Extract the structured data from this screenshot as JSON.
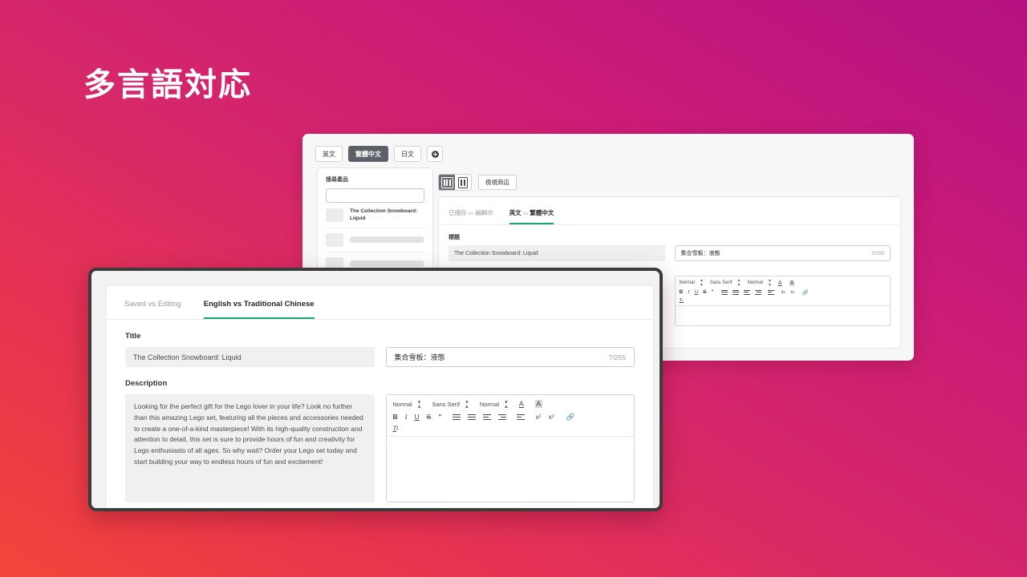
{
  "headline": "多言語対応",
  "colors": {
    "gradient_start": "#f4453a",
    "gradient_mid": "#d6276a",
    "gradient_end": "#b51283",
    "accent_green": "#18a37e",
    "tab_active_bg": "#5c6067"
  },
  "back_window": {
    "language_tabs": [
      {
        "label": "英文",
        "active": false
      },
      {
        "label": "繁體中文",
        "active": true
      },
      {
        "label": "日文",
        "active": false
      }
    ],
    "add_language_icon": "plus-circle-icon",
    "sidebar": {
      "search_label": "搜尋產品",
      "search_value": "",
      "products": [
        {
          "name": "The Collection Snowboard: Liquid",
          "skeleton": false
        },
        {
          "name": "",
          "skeleton": true
        },
        {
          "name": "",
          "skeleton": true
        }
      ]
    },
    "view_toggle": [
      {
        "icon": "three-column-icon",
        "active": true
      },
      {
        "icon": "two-column-icon",
        "active": false
      }
    ],
    "view_store_label": "檢視商店",
    "compare_tabs": [
      {
        "label_left": "已儲存",
        "vs": "vs",
        "label_right": "編輯中",
        "active": false
      },
      {
        "label_left": "英文",
        "vs": "vs",
        "label_right": "繁體中文",
        "active": true
      }
    ],
    "title_label": "標題",
    "title_source": "The Collection Snowboard: Liquid",
    "title_target": "集合雪板：液態",
    "title_counter": "7/255",
    "toolbar": {
      "heading_select": "Normal",
      "font_select": "Sans Serif",
      "size_select": "Normal",
      "font_color_icon": "font-color-icon",
      "highlight_icon": "highlight-color-icon",
      "bold": "B",
      "italic": "I",
      "underline": "U",
      "strike": "S",
      "quote": "”",
      "ordered_list_icon": "ordered-list-icon",
      "bullet_list_icon": "bullet-list-icon",
      "outdent_icon": "outdent-icon",
      "indent_icon": "indent-icon",
      "align_icon": "align-icon",
      "subscript": "x",
      "subscript_sub": "2",
      "superscript": "x",
      "superscript_sup": "2",
      "link_icon": "link-icon",
      "clear_format": "T",
      "clear_format_sub": "x"
    }
  },
  "front_window": {
    "compare_tabs": [
      {
        "label": "Saved vs Editing",
        "active": false
      },
      {
        "label": "English vs Traditional Chinese",
        "active": true
      }
    ],
    "title_label": "Title",
    "title_source": "The Collection Snowboard: Liquid",
    "title_target": "集合雪板：液態",
    "title_counter": "7/255",
    "description_label": "Description",
    "description_source": "Looking for the perfect gift for the Lego lover in your life? Look no further than this amazing Lego set, featuring all the pieces and accessories needed to create a one-of-a-kind masterpiece! With its high-quality construction and attention to detail, this set is sure to provide hours of fun and creativity for Lego enthusiasts of all ages. So why wait? Order your Lego set today and start building your way to endless hours of fun and excitement!",
    "description_target": "",
    "toolbar": {
      "heading_select": "Normal",
      "font_select": "Sans Serif",
      "size_select": "Normal",
      "font_color_icon": "font-color-icon",
      "highlight_icon": "highlight-color-icon",
      "bold": "B",
      "italic": "I",
      "underline": "U",
      "strike": "S",
      "quote": "”",
      "ordered_list_icon": "ordered-list-icon",
      "bullet_list_icon": "bullet-list-icon",
      "outdent_icon": "outdent-icon",
      "indent_icon": "indent-icon",
      "align_icon": "align-icon",
      "subscript": "x",
      "subscript_sub": "2",
      "superscript": "x",
      "superscript_sup": "2",
      "link_icon": "link-icon",
      "clear_format": "T",
      "clear_format_sub": "x"
    }
  }
}
